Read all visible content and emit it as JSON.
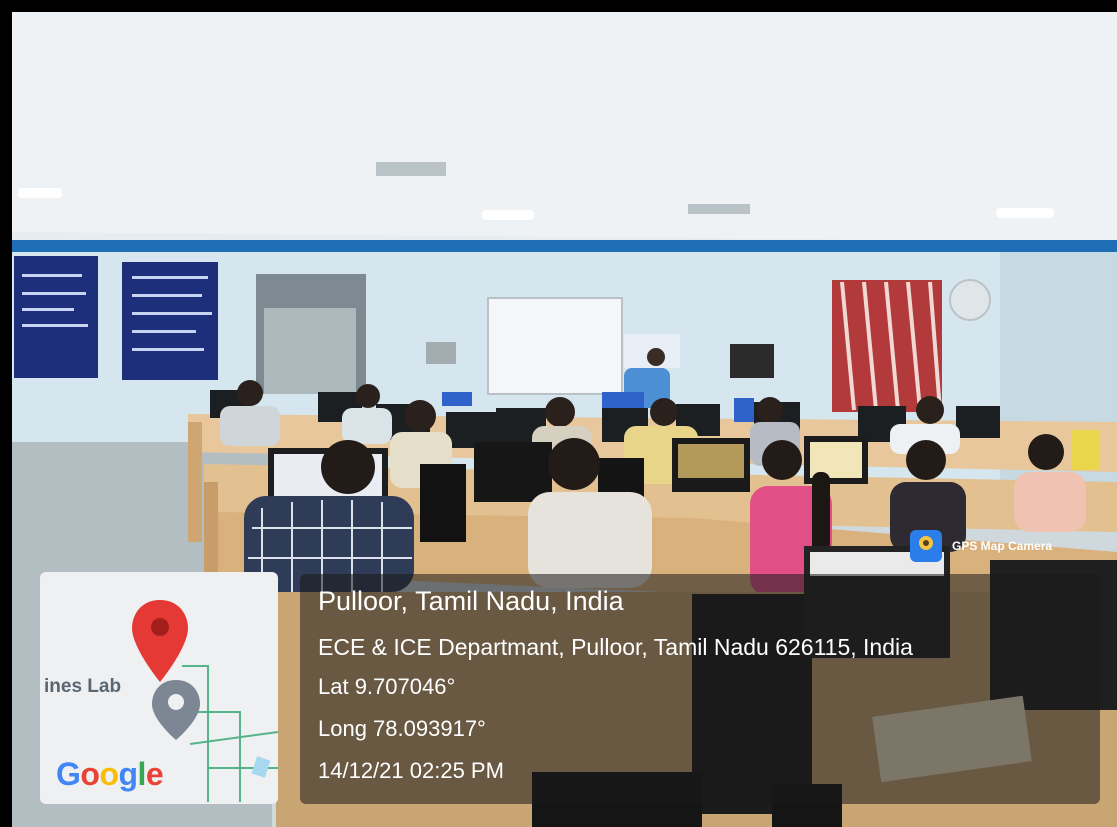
{
  "location": {
    "place": "Pulloor, Tamil Nadu, India",
    "address": "ECE & ICE Departmant, Pulloor, Tamil Nadu 626115, India",
    "latitude": "Lat 9.707046°",
    "longitude": "Long 78.093917°",
    "timestamp": "14/12/21 02:25 PM"
  },
  "map": {
    "label": "ines Lab",
    "brand": "Google",
    "pin_icon": "map-pin-icon"
  },
  "badge": {
    "label": "GPS Map Camera",
    "icon": "gps-map-camera-icon"
  },
  "colors": {
    "pin_red": "#e53935",
    "panel_text": "#ffffff",
    "wall_trim": "#1f6fb6"
  }
}
